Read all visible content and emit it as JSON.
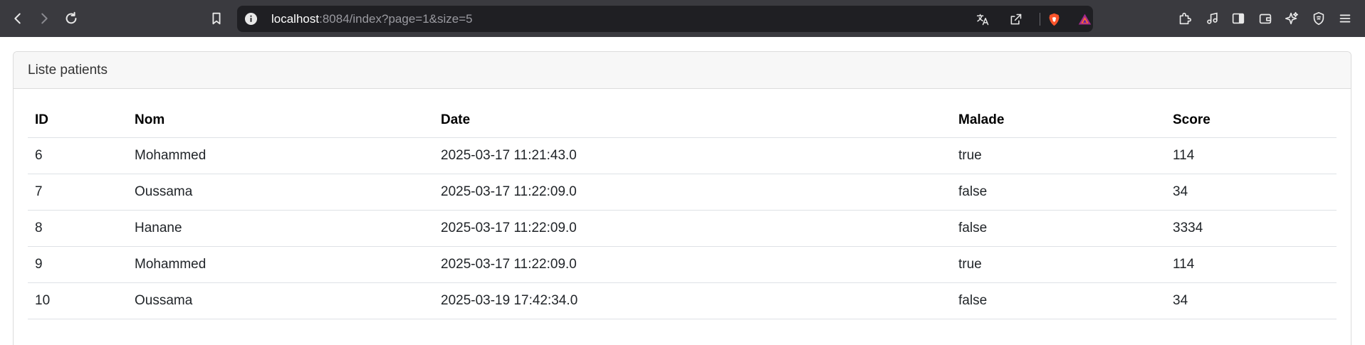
{
  "browser": {
    "url_host": "localhost",
    "url_rest": ":8084/index?page=1&size=5"
  },
  "card": {
    "title": "Liste patients"
  },
  "table": {
    "headers": [
      "ID",
      "Nom",
      "Date",
      "Malade",
      "Score"
    ],
    "rows": [
      [
        "6",
        "Mohammed",
        "2025-03-17 11:21:43.0",
        "true",
        "114"
      ],
      [
        "7",
        "Oussama",
        "2025-03-17 11:22:09.0",
        "false",
        "34"
      ],
      [
        "8",
        "Hanane",
        "2025-03-17 11:22:09.0",
        "false",
        "3334"
      ],
      [
        "9",
        "Mohammed",
        "2025-03-17 11:22:09.0",
        "true",
        "114"
      ],
      [
        "10",
        "Oussama",
        "2025-03-19 17:42:34.0",
        "false",
        "34"
      ]
    ]
  },
  "icons": {
    "nav": [
      "back-icon",
      "forward-icon",
      "reload-icon",
      "bookmark-icon"
    ],
    "url": [
      "info-icon",
      "translate-icon",
      "share-icon",
      "brave-shields-icon",
      "brave-rewards-icon"
    ],
    "right": [
      "extensions-icon",
      "media-icon",
      "sidebar-icon",
      "wallet-icon",
      "leo-ai-icon",
      "vpn-icon",
      "menu-icon"
    ]
  },
  "colors": {
    "toolbar_bg": "#3a3a3f",
    "urlbar_bg": "#1f1f23",
    "card_header_bg": "#f7f7f7",
    "brave_orange": "#fb542b"
  }
}
